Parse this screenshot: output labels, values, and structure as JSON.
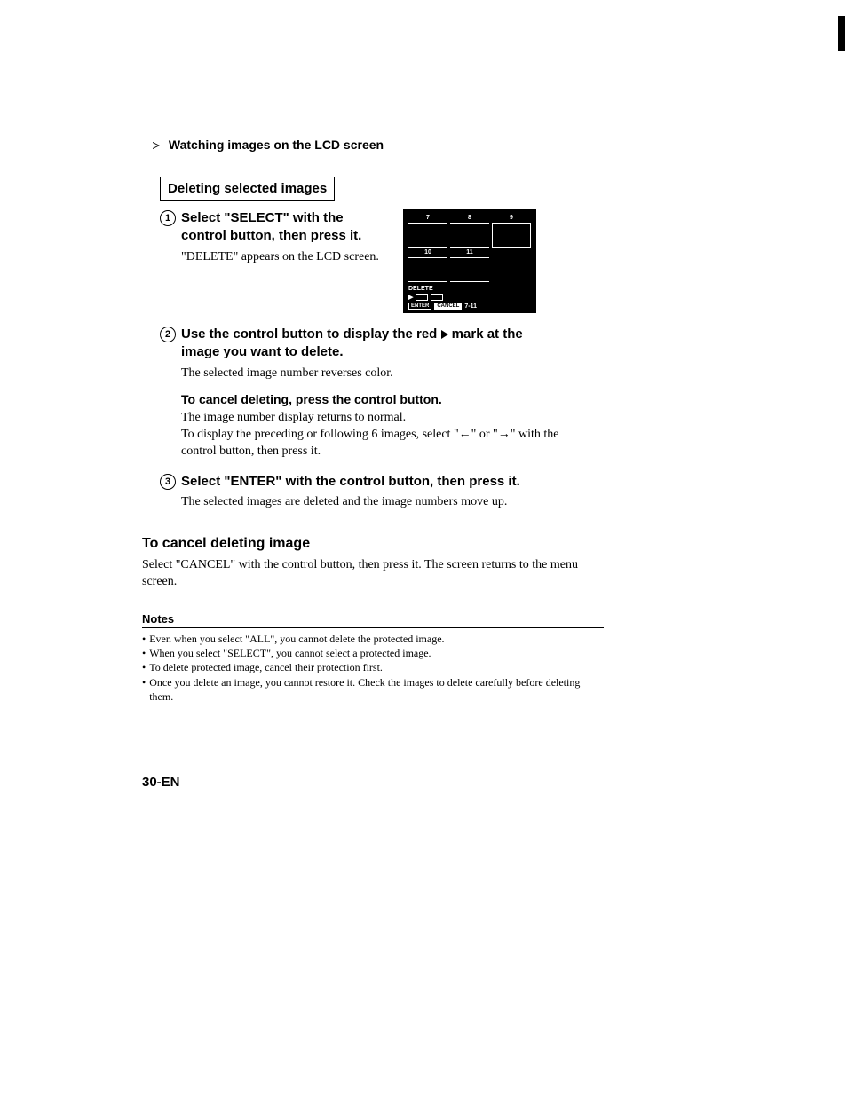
{
  "breadcrumb": "Watching images on the LCD screen",
  "section_title": "Deleting selected images",
  "step1": {
    "num": "1",
    "heading": "Select \"SELECT\" with the control button, then press it.",
    "body": "\"DELETE\" appears on the LCD screen."
  },
  "lcd": {
    "top_labels": [
      "7",
      "8",
      "9"
    ],
    "mid_labels": [
      "10",
      "11",
      ""
    ],
    "menu_label": "DELETE",
    "buttons": [
      "ENTER",
      "CANCEL"
    ],
    "range": "7-11"
  },
  "step2": {
    "num": "2",
    "heading": "Use the control button to display the red ▶ mark at the image you want to delete.",
    "body": "The selected image number reverses color.",
    "sub_heading": "To cancel deleting, press the control button.",
    "sub_body": "The image number display returns to normal.\nTo display the preceding or following 6 images, select \"←\" or \"→\" with the control button, then press it."
  },
  "step3": {
    "num": "3",
    "heading": "Select \"ENTER\" with the control button, then press it.",
    "body": "The selected images are deleted and the image numbers move up."
  },
  "cancel": {
    "heading": "To cancel deleting image",
    "body": "Select \"CANCEL\" with the control button, then press it. The screen returns to the menu screen."
  },
  "notes": {
    "heading": "Notes",
    "items": [
      "Even when you select \"ALL\", you cannot delete the protected image.",
      "When you select \"SELECT\", you cannot select a protected image.",
      "To delete protected image, cancel their protection first.",
      "Once you delete an image, you cannot restore it. Check the images to delete carefully before deleting them."
    ]
  },
  "page_number": "30-EN"
}
